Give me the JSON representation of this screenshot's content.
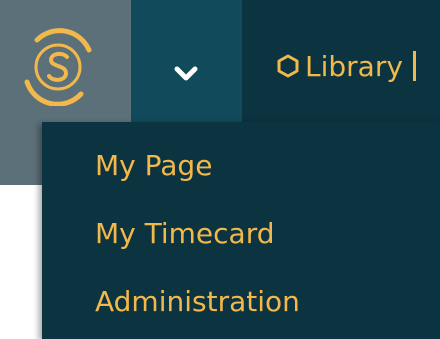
{
  "navbar": {
    "logo_icon": "s-logo-icon",
    "toggle_icon": "chevron-down-icon",
    "library_icon": "hexagon-icon",
    "library_label": "Library"
  },
  "dropdown": {
    "items": [
      {
        "label": "My Page"
      },
      {
        "label": "My Timecard"
      },
      {
        "label": "Administration"
      }
    ]
  },
  "colors": {
    "navbar_bg": "#0c3340",
    "logo_bg": "#5c7079",
    "toggle_bg": "#114a5a",
    "accent": "#f2b84b"
  }
}
